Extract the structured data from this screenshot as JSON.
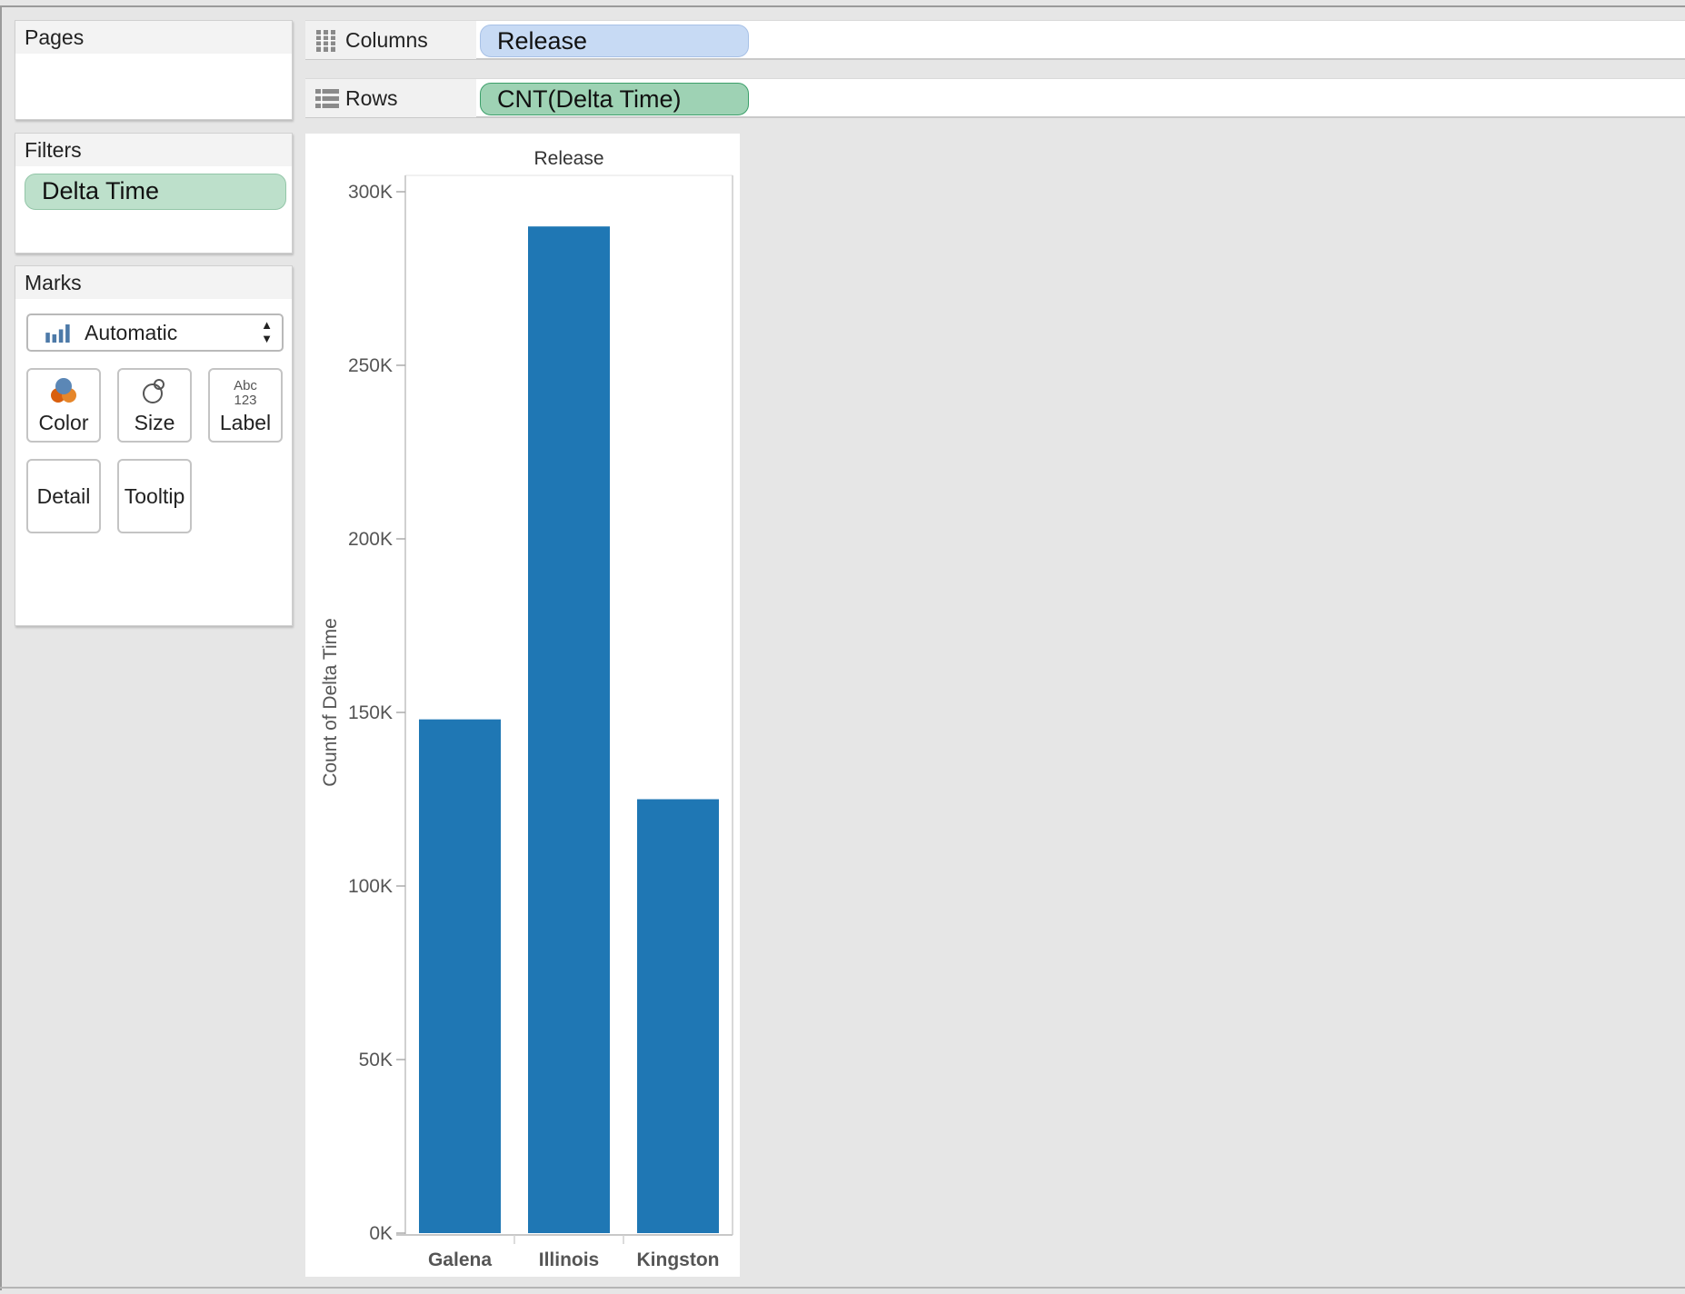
{
  "cards": {
    "pages": {
      "title": "Pages"
    },
    "filters": {
      "title": "Filters",
      "pills": [
        "Delta Time"
      ]
    },
    "marks": {
      "title": "Marks",
      "mark_type": "Automatic",
      "buttons": {
        "color": "Color",
        "size": "Size",
        "label": "Label",
        "detail": "Detail",
        "tooltip": "Tooltip"
      },
      "label_icon_text": {
        "top": "Abc",
        "bottom": "123"
      }
    }
  },
  "shelves": {
    "columns": {
      "label": "Columns",
      "pill": "Release"
    },
    "rows": {
      "label": "Rows",
      "pill": "CNT(Delta Time)"
    }
  },
  "colors": {
    "bar": "#1f77b4",
    "dimension_pill": "#c7daf4",
    "measure_pill": "#9ed2b4",
    "filter_pill": "#bde0cb"
  },
  "chart_data": {
    "type": "bar",
    "title": "Release",
    "xlabel": "",
    "ylabel": "Count of Delta Time",
    "categories": [
      "Galena",
      "Illinois",
      "Kingston"
    ],
    "values": [
      148000,
      290000,
      125000
    ],
    "ylim": [
      0,
      300000
    ],
    "yticks": [
      0,
      50000,
      100000,
      150000,
      200000,
      250000,
      300000
    ],
    "ytick_labels": [
      "0K",
      "50K",
      "100K",
      "150K",
      "200K",
      "250K",
      "300K"
    ],
    "grid": false,
    "legend": "none"
  }
}
